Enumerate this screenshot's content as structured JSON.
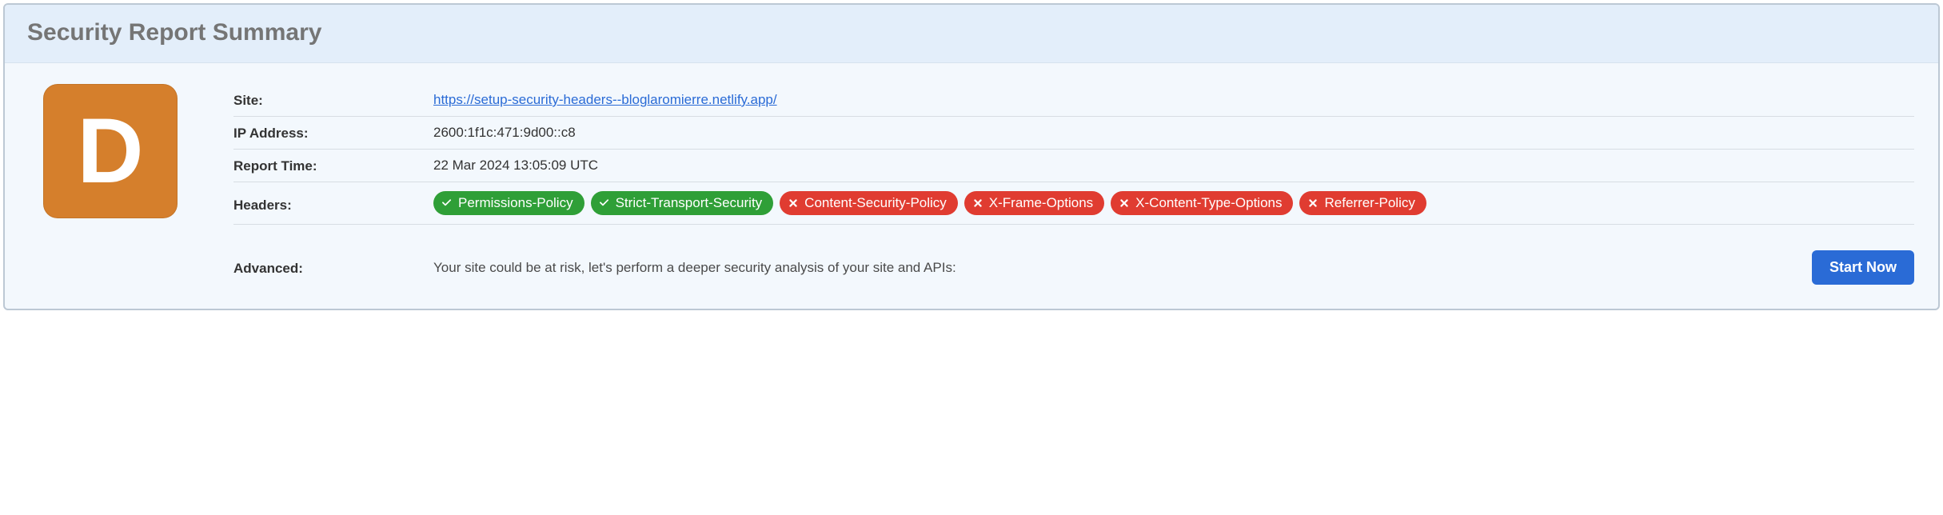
{
  "title": "Security Report Summary",
  "grade": "D",
  "labels": {
    "site": "Site:",
    "ip": "IP Address:",
    "time": "Report Time:",
    "headers": "Headers:",
    "advanced": "Advanced:"
  },
  "site_url": "https://setup-security-headers--bloglaromierre.netlify.app/",
  "ip_address": "2600:1f1c:471:9d00::c8",
  "report_time": "22 Mar 2024 13:05:09 UTC",
  "headers": [
    {
      "name": "Permissions-Policy",
      "pass": true
    },
    {
      "name": "Strict-Transport-Security",
      "pass": true
    },
    {
      "name": "Content-Security-Policy",
      "pass": false
    },
    {
      "name": "X-Frame-Options",
      "pass": false
    },
    {
      "name": "X-Content-Type-Options",
      "pass": false
    },
    {
      "name": "Referrer-Policy",
      "pass": false
    }
  ],
  "advanced_text": "Your site could be at risk, let's perform a deeper security analysis of your site and APIs:",
  "start_now": "Start Now"
}
